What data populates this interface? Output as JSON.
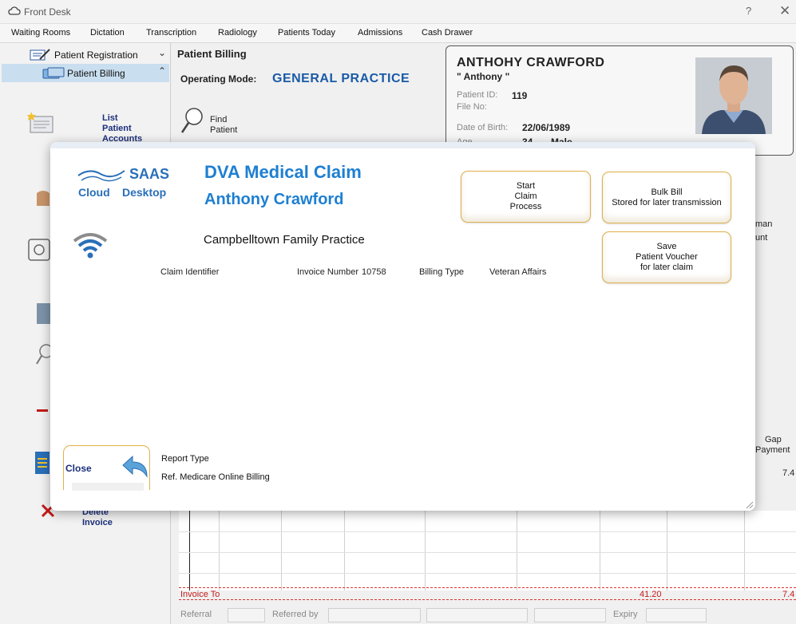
{
  "window": {
    "title": "Front Desk",
    "help": "?",
    "close": "✕"
  },
  "menu": [
    "Waiting Rooms",
    "Dictation",
    "Transcription",
    "Radiology",
    "Patients Today",
    "Admissions",
    "Cash Drawer"
  ],
  "sidebar": {
    "registration": "Patient Registration",
    "billing": "Patient Billing",
    "list_accounts": [
      "List",
      "Patient",
      "Accounts"
    ],
    "delete_invoice": [
      "Delete",
      "Invoice"
    ]
  },
  "main": {
    "section_title": "Patient Billing",
    "operating_mode_label": "Operating Mode:",
    "operating_mode_value": "GENERAL PRACTICE",
    "find_patient": [
      "Find",
      "Patient"
    ]
  },
  "patient": {
    "name": "ANTHOHY CRAWFORD",
    "nickname": "\" Anthony \"",
    "id_label": "Patient ID:",
    "id": "119",
    "file_label": "File No:",
    "dob_label": "Date of Birth:",
    "dob": "22/06/1989",
    "age_label": "Age",
    "age": "34",
    "sex": "Male"
  },
  "background_right": {
    "col_a": "man",
    "col_b": "unt",
    "gap": "Gap",
    "payment": "Payment",
    "gap_value": "7.4"
  },
  "totals": {
    "label": "Invoice To",
    "amount": "41.20",
    "gap": "7.4"
  },
  "footer": {
    "referral": "Referral",
    "referred_by": "Referred by",
    "expiry": "Expiry"
  },
  "dialog": {
    "logo_saas": "SAAS",
    "logo_cloud": "Cloud",
    "logo_desktop": "Desktop",
    "title": "DVA Medical Claim",
    "patient_name": "Anthony Crawford",
    "practice": "Campbelltown Family Practice",
    "claim_identifier_label": "Claim Identifier",
    "invoice_label": "Invoice Number",
    "invoice_number": "10758",
    "billing_type_label": "Billing Type",
    "billing_type": "Veteran Affairs",
    "start_btn": [
      "Start",
      "Claim",
      "Process"
    ],
    "bulk_btn": [
      "Bulk Bill",
      "Stored for later transmission"
    ],
    "save_btn": [
      "Save",
      "Patient Voucher",
      "for later claim"
    ],
    "close_btn": "Close",
    "report_type_label": "Report Type",
    "report_type_value": "Ref. Medicare Online Billing"
  },
  "colors": {
    "accent": "#1e7fd1",
    "button_border": "#e0b14a",
    "link": "#1b2f7a",
    "total_red": "#c41a1a"
  }
}
